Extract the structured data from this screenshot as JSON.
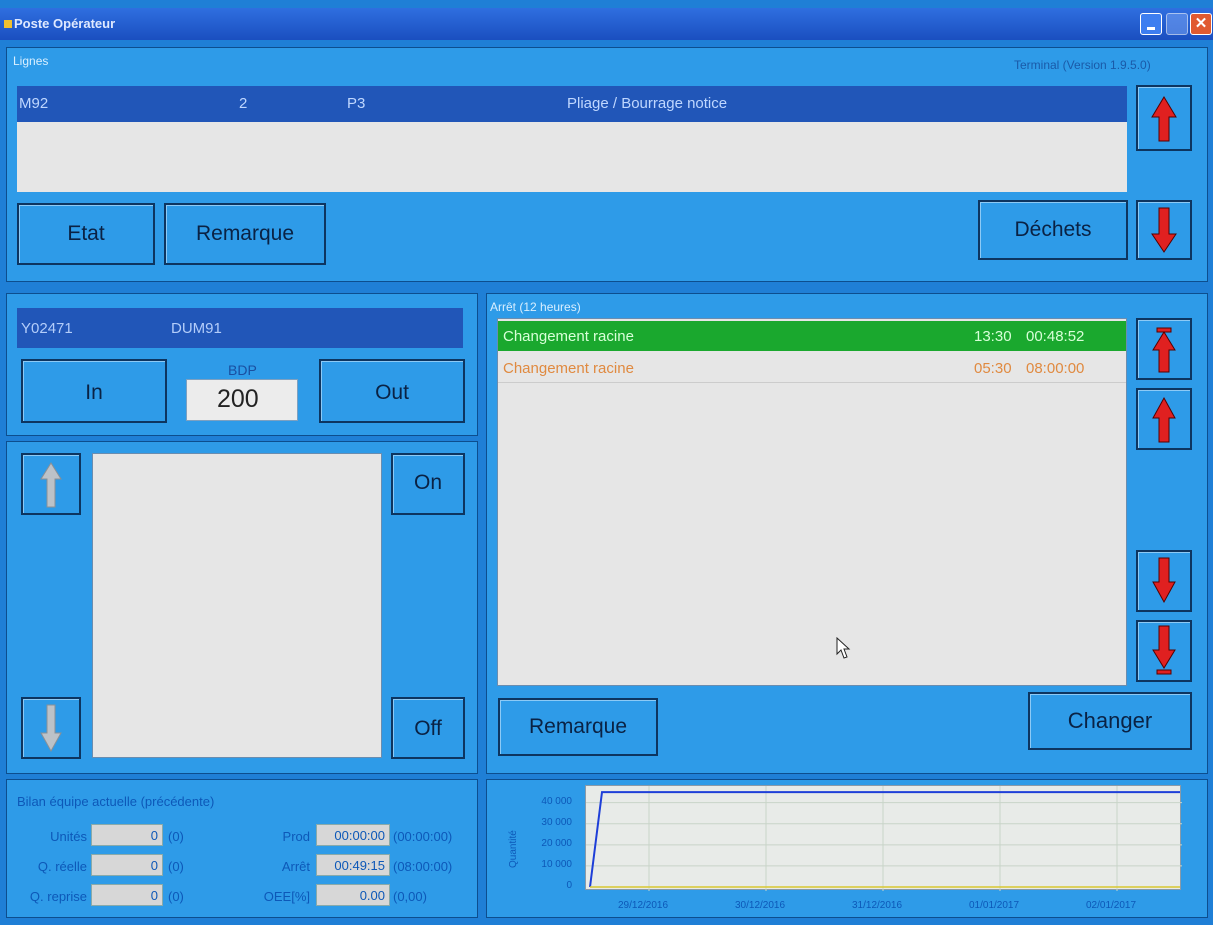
{
  "window": {
    "title": "Poste Opérateur",
    "close_glyph": "✕"
  },
  "lignes": {
    "label": "Lignes",
    "version": "Terminal (Version 1.9.5.0)",
    "row": {
      "machine": "M92",
      "num": "2",
      "poste": "P3",
      "operation": "Pliage / Bourrage notice"
    },
    "buttons": {
      "etat": "Etat",
      "remarque": "Remarque",
      "dechets": "Déchets"
    }
  },
  "article": {
    "code": "Y02471",
    "ref": "DUM91",
    "in_label": "In",
    "out_label": "Out",
    "bdp_label": "BDP",
    "bdp_value": "200"
  },
  "list_panel": {
    "on_label": "On",
    "off_label": "Off"
  },
  "arret": {
    "label": "Arrêt (12 heures)",
    "items": [
      {
        "name": "Changement racine",
        "time": "13:30",
        "duration": "00:48:52",
        "selected": true
      },
      {
        "name": "Changement racine",
        "time": "05:30",
        "duration": "08:00:00",
        "selected": false
      }
    ],
    "remarque_label": "Remarque",
    "changer_label": "Changer"
  },
  "bilan": {
    "label": "Bilan équipe actuelle (précédente)",
    "rows": [
      {
        "label": "Unités",
        "value": "0",
        "prev": "(0)",
        "label2": "Prod",
        "value2": "00:00:00",
        "prev2": "(00:00:00)"
      },
      {
        "label": "Q. réelle",
        "value": "0",
        "prev": "(0)",
        "label2": "Arrêt",
        "value2": "00:49:15",
        "prev2": "(08:00:00)"
      },
      {
        "label": "Q. reprise",
        "value": "0",
        "prev": "(0)",
        "label2": "OEE[%]",
        "value2": "0.00",
        "prev2": "(0,00)"
      }
    ]
  },
  "chart_data": {
    "type": "line",
    "ylabel": "Quantité",
    "yticks": [
      "40 000",
      "30 000",
      "20 000",
      "10 000",
      "0"
    ],
    "ylim": [
      0,
      46000
    ],
    "xticks": [
      "29/12/2016",
      "30/12/2016",
      "31/12/2016",
      "01/01/2017",
      "02/01/2017"
    ],
    "series": [
      {
        "x": [
          "28/12/2016",
          "28/12/2016",
          "02/01/2017"
        ],
        "values": [
          0,
          45000,
          45000
        ],
        "color": "#1e3fd8"
      },
      {
        "x": [
          "28/12/2016",
          "02/01/2017"
        ],
        "values": [
          0,
          0
        ],
        "color": "#d8c830"
      }
    ],
    "grid": true
  },
  "colors": {
    "panel": "#2e9be8",
    "selected_row": "#1aa82e",
    "arret_text": "#e08a40",
    "arrow_up": "#e02020"
  }
}
